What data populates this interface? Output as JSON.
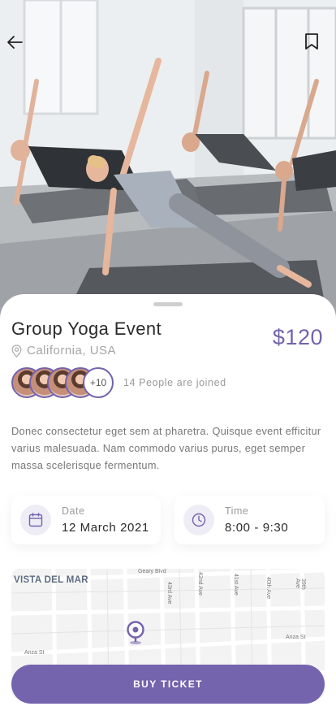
{
  "event": {
    "title": "Group Yoga Event",
    "price": "$120",
    "location": "California, USA",
    "joined_more": "+10",
    "joined_text": "14 People are joined",
    "description": "Donec consectetur eget sem at pharetra. Quisque event efficitur varius malesuada. Nam commodo varius purus, eget semper massa scelerisque fermentum."
  },
  "details": {
    "date_label": "Date",
    "date_value": "12 March 2021",
    "time_label": "Time",
    "time_value": "8:00 - 9:30"
  },
  "map": {
    "district": "VISTA DEL MAR",
    "streets": [
      "Geary Blvd",
      "43rd Ave",
      "42nd Ave",
      "41st Ave",
      "40th Ave",
      "39th Ave",
      "Anza St",
      "Anza St"
    ]
  },
  "actions": {
    "buy_label": "BUY TICKET"
  },
  "icons": {
    "back": "arrow-left-icon",
    "bookmark": "bookmark-icon",
    "location": "map-pin-icon",
    "date": "calendar-icon",
    "time": "clock-icon",
    "map_marker": "map-marker-icon"
  },
  "colors": {
    "accent": "#7463ad",
    "accent_light": "#eeedf6"
  }
}
